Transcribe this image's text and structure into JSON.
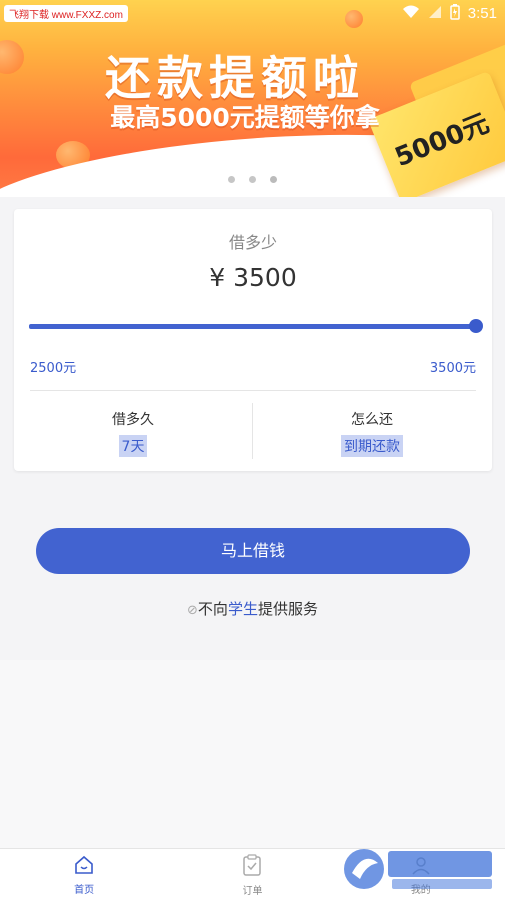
{
  "status_bar": {
    "watermark": "飞翔下载 www.FXXZ.com",
    "time": "3:51"
  },
  "banner": {
    "title": "还款提额啦",
    "subtitle": "最高5000元提额等你拿",
    "coupon_text": "5000元",
    "slide_count": 3,
    "active_slide": 3
  },
  "loan": {
    "question_label": "借多少",
    "amount": "¥ 3500",
    "slider_fraction": 1.0,
    "range_min": "2500元",
    "range_max": "3500元",
    "term_label": "借多久",
    "term_value": "7天",
    "repay_label": "怎么还",
    "repay_value": "到期还款"
  },
  "action": {
    "borrow_button": "马上借钱",
    "notice_prefix": "不向",
    "notice_highlight": "学生",
    "notice_suffix": "提供服务"
  },
  "bottom_nav": {
    "items": [
      {
        "label": "首页",
        "icon": "home-icon",
        "active": true
      },
      {
        "label": "订单",
        "icon": "order-icon",
        "active": false
      },
      {
        "label": "我的",
        "icon": "profile-icon",
        "active": false
      }
    ]
  },
  "colors": {
    "accent": "#4263d0",
    "banner_top": "#ffd24f",
    "banner_bottom": "#ff6a3a"
  }
}
